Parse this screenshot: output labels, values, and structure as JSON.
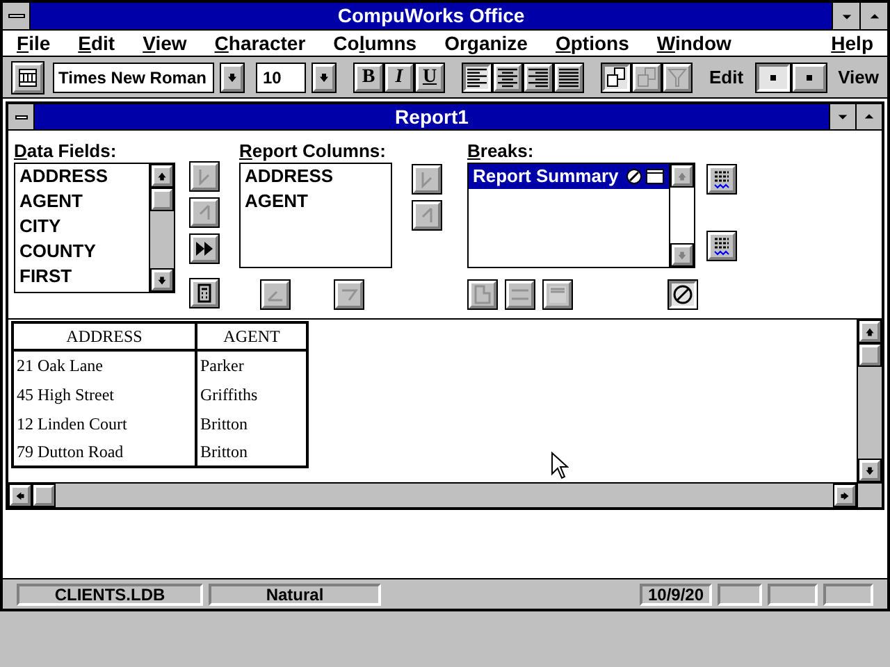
{
  "window": {
    "title": "CompuWorks Office"
  },
  "menu": [
    {
      "key": "F",
      "tail": "ile"
    },
    {
      "key": "E",
      "tail": "dit"
    },
    {
      "key": "V",
      "tail": "iew"
    },
    {
      "key": "C",
      "tail": "haracter"
    },
    {
      "lead": "Co",
      "key": "l",
      "tail": "umns"
    },
    {
      "tail": "Organize"
    },
    {
      "key": "O",
      "tail": "ptions"
    },
    {
      "key": "W",
      "tail": "indow"
    },
    {
      "key": "H",
      "tail": "elp"
    }
  ],
  "toolbar": {
    "font_name": "Times New Roman",
    "font_size": "10",
    "styles": [
      {
        "label": "B",
        "kind": "bold",
        "selected": false
      },
      {
        "label": "I",
        "kind": "italic",
        "selected": false
      },
      {
        "label": "U",
        "kind": "underline",
        "selected": false
      }
    ],
    "alignments": [
      {
        "kind": "left",
        "selected": true
      },
      {
        "kind": "center",
        "selected": false
      },
      {
        "kind": "right",
        "selected": false
      },
      {
        "kind": "justify",
        "selected": false
      }
    ],
    "tools": [
      {
        "kind": "copy",
        "selected": true,
        "disabled": false
      },
      {
        "kind": "copy",
        "selected": false,
        "disabled": true
      },
      {
        "kind": "filter",
        "selected": false,
        "disabled": true
      }
    ],
    "edit_label": "Edit",
    "modes": [
      {
        "selected": true
      },
      {
        "selected": false
      }
    ],
    "view_label": "View"
  },
  "document": {
    "title": "Report1",
    "data_fields": {
      "label": {
        "key": "D",
        "tail": "ata Fields:"
      },
      "items": [
        "ADDRESS",
        "AGENT",
        "CITY",
        "COUNTY",
        "FIRST"
      ]
    },
    "field_buttons": [
      {
        "kind": "add",
        "disabled": true
      },
      {
        "kind": "remove",
        "disabled": true
      },
      {
        "kind": "add_all",
        "disabled": false
      },
      {
        "kind": "calc",
        "disabled": false
      }
    ],
    "report_columns": {
      "label": {
        "key": "R",
        "tail": "eport Columns:"
      },
      "items": [
        "ADDRESS",
        "AGENT"
      ]
    },
    "column_buttons": [
      {
        "kind": "add",
        "disabled": true
      },
      {
        "kind": "remove",
        "disabled": true
      }
    ],
    "bottom_buttons": [
      {
        "kind": "left",
        "disabled": true
      },
      {
        "kind": "right",
        "disabled": true
      }
    ],
    "breaks": {
      "label": {
        "key": "B",
        "tail": "reaks:"
      },
      "items": [
        {
          "label": "Report Summary",
          "selected": true
        }
      ]
    },
    "break_buttons": [
      {
        "kind": "lines"
      },
      {
        "kind": "lines"
      }
    ],
    "break_tools": [
      {
        "kind": "page",
        "disabled": true
      },
      {
        "kind": "rule",
        "disabled": true
      },
      {
        "kind": "box",
        "disabled": true
      }
    ],
    "cancel_button": {
      "kind": "cancel",
      "selected": true
    },
    "table": {
      "columns": [
        "ADDRESS",
        "AGENT"
      ],
      "rows": [
        [
          "21 Oak Lane",
          "Parker"
        ],
        [
          "45 High Street",
          "Griffiths"
        ],
        [
          "12 Linden Court",
          "Britton"
        ],
        [
          "79 Dutton Road",
          "Britton"
        ]
      ]
    }
  },
  "status_bar": [
    "CLIENTS.LDB",
    "Natural",
    "10/9/20"
  ]
}
